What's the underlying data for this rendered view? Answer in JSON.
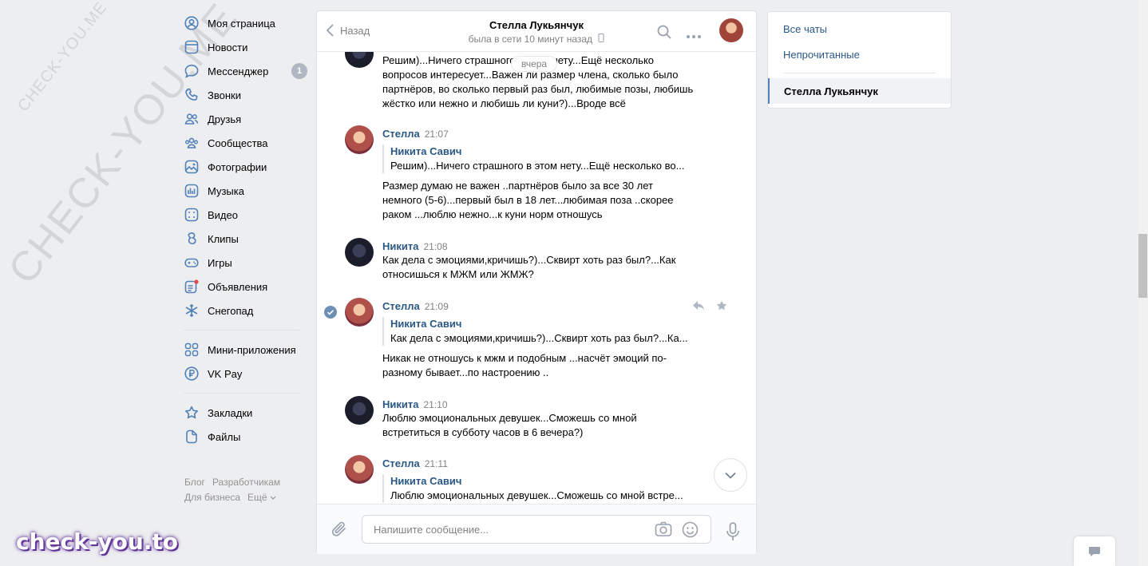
{
  "watermark": {
    "small": "CHECK-YOU.ME",
    "big": "CHECK-YOU.ME",
    "logo": "check-you.to"
  },
  "nav": {
    "items": [
      {
        "label": "Моя страница",
        "icon": "user-circle-icon"
      },
      {
        "label": "Новости",
        "icon": "news-icon"
      },
      {
        "label": "Мессенджер",
        "icon": "message-icon",
        "badge": "1"
      },
      {
        "label": "Звонки",
        "icon": "phone-icon"
      },
      {
        "label": "Друзья",
        "icon": "friends-icon"
      },
      {
        "label": "Сообщества",
        "icon": "communities-icon"
      },
      {
        "label": "Фотографии",
        "icon": "photo-icon"
      },
      {
        "label": "Музыка",
        "icon": "music-icon"
      },
      {
        "label": "Видео",
        "icon": "video-icon"
      },
      {
        "label": "Клипы",
        "icon": "clips-icon"
      },
      {
        "label": "Игры",
        "icon": "gamepad-icon"
      },
      {
        "label": "Объявления",
        "icon": "ads-icon"
      },
      {
        "label": "Снегопад",
        "icon": "snowflake-icon"
      }
    ],
    "group2": [
      {
        "label": "Мини-приложения",
        "icon": "apps-icon"
      },
      {
        "label": "VK Pay",
        "icon": "ruble-icon"
      }
    ],
    "group3": [
      {
        "label": "Закладки",
        "icon": "star-icon"
      },
      {
        "label": "Файлы",
        "icon": "file-icon"
      }
    ],
    "footer": {
      "blog": "Блог",
      "dev": "Разработчикам",
      "business": "Для бизнеса",
      "more": "Ещё"
    }
  },
  "chat": {
    "back_label": "Назад",
    "peer_name": "Стелла Лукьянчук",
    "peer_status": "была в сети 10 минут назад",
    "date_pill": "вчера",
    "messages": [
      {
        "text": "Решим)...Ничего страшного в этом нету...Ещё несколько вопросов интересует...Важен ли размер члена, сколько было партнёров, во сколько первый раз был, любимые позы, любишь жёстко или нежно и любишь ли куни?)...Вроде всё"
      },
      {
        "name": "Стелла",
        "time": "21:07",
        "quote_name": "Никита Савич",
        "quote_text": "Решим)...Ничего страшного в этом нету...Ещё несколько во...",
        "text": "Размер думаю не важен ..партнёров было за все 30 лет немного (5-6)...первый был в 18 лет...любимая поза ..скорее раком ...люблю нежно...к куни норм отношусь"
      },
      {
        "name": "Никита",
        "time": "21:08",
        "text": "Как дела с эмоциями,кричишь?)...Сквирт хоть раз был?...Как относишься к МЖМ или ЖМЖ?"
      },
      {
        "name": "Стелла",
        "time": "21:09",
        "quote_name": "Никита Савич",
        "quote_text": "Как дела с эмоциями,кричишь?)...Сквирт хоть раз был?...Ка...",
        "text": "Никак не отношусь к мжм и подобным ...насчёт эмоций по-разному бывает...по настроению .."
      },
      {
        "name": "Никита",
        "time": "21:10",
        "text": "Люблю эмоциональных девушек...Сможешь со мной встретиться в субботу часов в 6 вечера?)"
      },
      {
        "name": "Стелла",
        "time": "21:11",
        "quote_name": "Никита Савич",
        "quote_text": "Люблю эмоциональных девушек...Сможешь со мной встре..."
      }
    ],
    "composer_placeholder": "Напишите сообщение..."
  },
  "right_panel": {
    "all_chats": "Все чаты",
    "unread": "Непрочитанные",
    "active_chat": "Стелла Лукьянчук"
  },
  "colors": {
    "link": "#2a5885",
    "accent": "#5181b8",
    "bg": "#edeef0"
  }
}
